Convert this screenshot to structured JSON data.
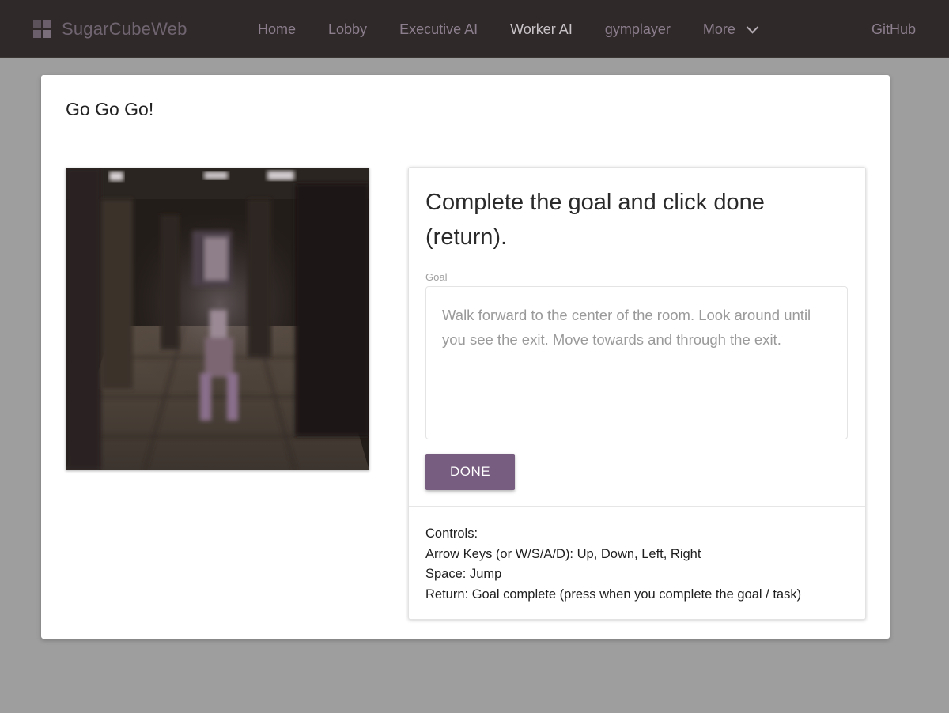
{
  "brand": {
    "name": "SugarCubeWeb",
    "icon": "grid-cube-icon"
  },
  "nav": {
    "items": [
      {
        "label": "Home",
        "active": false
      },
      {
        "label": "Lobby",
        "active": false
      },
      {
        "label": "Executive AI",
        "active": false
      },
      {
        "label": "Worker AI",
        "active": true
      },
      {
        "label": "gymplayer",
        "active": false
      },
      {
        "label": "More",
        "active": false,
        "icon": "chevron-down-icon"
      }
    ],
    "github": "GitHub"
  },
  "page": {
    "title": "Go Go Go!"
  },
  "game_view": {
    "icon": "game-viewport-icon"
  },
  "panel": {
    "heading": "Complete the goal and click done (return).",
    "goal_label": "Goal",
    "goal_text": "Walk forward to the center of the room. Look around until you see the exit. Move towards and through the exit.",
    "done_label": "DONE",
    "controls": [
      "Controls:",
      "Arrow Keys (or W/S/A/D): Up, Down, Left, Right",
      "Space: Jump",
      "Return: Goal complete (press when you complete the goal / task)"
    ]
  },
  "colors": {
    "nav_bg": "#2f2a29",
    "accent": "#775d7f",
    "page_bg": "#9e9e9e"
  }
}
